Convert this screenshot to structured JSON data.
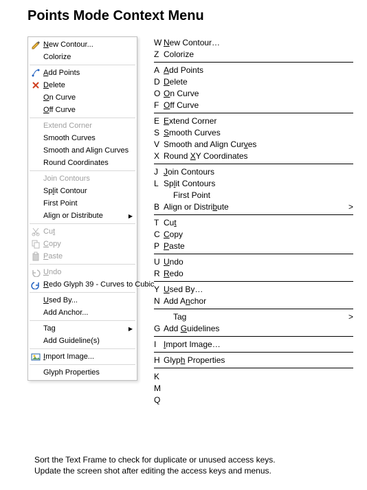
{
  "title": "Points Mode Context Menu",
  "menu": {
    "groups": [
      [
        {
          "label": "New Contour...",
          "icon": "pencil",
          "ak": "N"
        },
        {
          "label": "Colorize",
          "icon": "",
          "ak": ""
        }
      ],
      [
        {
          "label": "Add Points",
          "icon": "addpoints",
          "ak": "A"
        },
        {
          "label": "Delete",
          "icon": "delete",
          "ak": "D"
        },
        {
          "label": "On Curve",
          "icon": "",
          "ak": "O"
        },
        {
          "label": "Off Curve",
          "icon": "",
          "ak": "O"
        }
      ],
      [
        {
          "label": "Extend Corner",
          "icon": "",
          "ak": "",
          "disabled": true
        },
        {
          "label": "Smooth Curves",
          "icon": "",
          "ak": ""
        },
        {
          "label": "Smooth and Align Curves",
          "icon": "",
          "ak": ""
        },
        {
          "label": "Round Coordinates",
          "icon": "",
          "ak": ""
        }
      ],
      [
        {
          "label": "Join Contours",
          "icon": "",
          "ak": "",
          "disabled": true
        },
        {
          "label": "Split Contour",
          "icon": "",
          "ak": "l"
        },
        {
          "label": "First Point",
          "icon": "",
          "ak": ""
        },
        {
          "label": "Align or Distribute",
          "icon": "",
          "ak": "",
          "sub": true
        }
      ],
      [
        {
          "label": "Cut",
          "icon": "cut",
          "ak": "t",
          "disabled": true
        },
        {
          "label": "Copy",
          "icon": "copy",
          "ak": "C",
          "disabled": true
        },
        {
          "label": "Paste",
          "icon": "paste",
          "ak": "P",
          "disabled": true
        }
      ],
      [
        {
          "label": "Undo",
          "icon": "undo",
          "ak": "U",
          "disabled": true
        },
        {
          "label": "Redo Glyph 39 - Curves to Cubic",
          "icon": "redo",
          "ak": "R"
        }
      ],
      [
        {
          "label": "Used By...",
          "icon": "",
          "ak": "U"
        },
        {
          "label": "Add Anchor...",
          "icon": "",
          "ak": ""
        }
      ],
      [
        {
          "label": "Tag",
          "icon": "",
          "ak": "",
          "sub": true
        },
        {
          "label": "Add Guideline(s)",
          "icon": "",
          "ak": ""
        }
      ],
      [
        {
          "label": "Import Image...",
          "icon": "image",
          "ak": "I"
        }
      ],
      [
        {
          "label": "Glyph Properties",
          "icon": "",
          "ak": ""
        }
      ]
    ]
  },
  "reference": {
    "groups": [
      [
        {
          "k": "W",
          "pre": "",
          "u": "N",
          "post": "ew Contour…"
        },
        {
          "k": "Z",
          "pre": "Colorize",
          "u": "",
          "post": ""
        }
      ],
      [
        {
          "k": "A",
          "pre": "",
          "u": "A",
          "post": "dd Points"
        },
        {
          "k": "D",
          "pre": "",
          "u": "D",
          "post": "elete"
        },
        {
          "k": "O",
          "pre": "",
          "u": "O",
          "post": "n Curve"
        },
        {
          "k": "F",
          "pre": "",
          "u": "O",
          "post": "ff Curve"
        }
      ],
      [
        {
          "k": "E",
          "pre": "",
          "u": "E",
          "post": "xtend Corner"
        },
        {
          "k": "S",
          "pre": "",
          "u": "S",
          "post": "mooth Curves"
        },
        {
          "k": "V",
          "pre": "Smooth and Align Cur",
          "u": "v",
          "post": "es"
        },
        {
          "k": "X",
          "pre": "Round ",
          "u": "X",
          "post": "Y Coordinates"
        }
      ],
      [
        {
          "k": "J",
          "pre": "",
          "u": "J",
          "post": "oin Contours"
        },
        {
          "k": "L",
          "pre": "Sp",
          "u": "l",
          "post": "it Contours"
        },
        {
          "k": "",
          "pre": "",
          "u": "",
          "post": "First Point",
          "indent": true
        },
        {
          "k": "B",
          "pre": "Align or Distri",
          "u": "b",
          "post": "ute",
          "suffix": ">"
        }
      ],
      [
        {
          "k": "T",
          "pre": "Cu",
          "u": "t",
          "post": ""
        },
        {
          "k": "C",
          "pre": "",
          "u": "C",
          "post": "opy"
        },
        {
          "k": "P",
          "pre": "",
          "u": "P",
          "post": "aste"
        }
      ],
      [
        {
          "k": "U",
          "pre": "",
          "u": "U",
          "post": "ndo"
        },
        {
          "k": "R",
          "pre": "",
          "u": "R",
          "post": "edo"
        }
      ],
      [
        {
          "k": "Y",
          "pre": "",
          "u": "U",
          "post": "sed By…"
        },
        {
          "k": "N",
          "pre": "Add A",
          "u": "n",
          "post": "chor"
        }
      ],
      [
        {
          "k": "",
          "pre": "Tag",
          "u": "",
          "post": "",
          "indent": true,
          "suffix": ">"
        },
        {
          "k": "G",
          "pre": "Add ",
          "u": "G",
          "post": "uidelines"
        }
      ],
      [
        {
          "k": "I",
          "pre": "",
          "u": "I",
          "post": "mport Image…"
        }
      ],
      [
        {
          "k": "H",
          "pre": "Glyp",
          "u": "h",
          "post": " Properties"
        }
      ],
      [
        {
          "k": "K",
          "pre": "",
          "u": "",
          "post": ""
        },
        {
          "k": "M",
          "pre": "",
          "u": "",
          "post": ""
        },
        {
          "k": "Q",
          "pre": "",
          "u": "",
          "post": ""
        }
      ]
    ]
  },
  "footer": {
    "line1": "Sort the Text Frame to check for duplicate or unused access keys.",
    "line2": "Update the screen shot after editing the access keys and menus."
  }
}
